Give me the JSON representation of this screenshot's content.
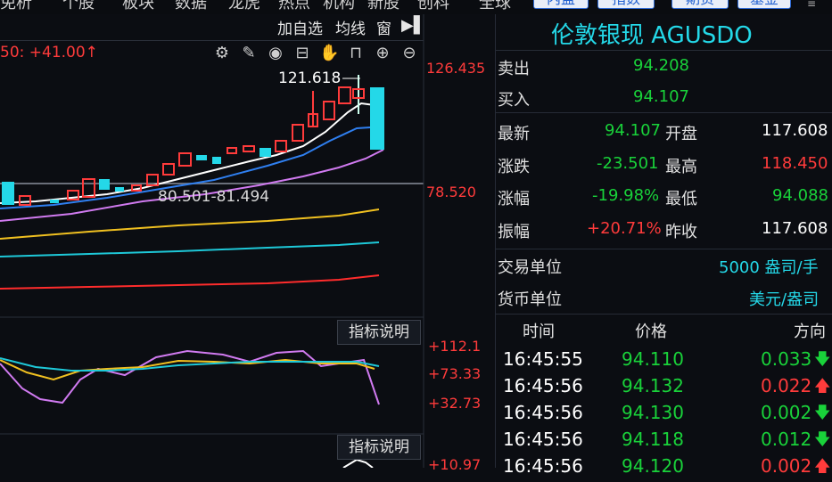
{
  "top_menu": [
    "免析",
    "个股",
    "板块",
    "数据",
    "龙虎",
    "热点",
    "机构",
    "新股",
    "创科",
    "全球"
  ],
  "top_tabs": [
    "内盘",
    "指数",
    "期货",
    "基金"
  ],
  "toolbar": {
    "add_watch": "加自选",
    "ma_label": "均线",
    "window_label": "窗"
  },
  "indicator_text": "50: +41.00↑",
  "chart": {
    "high_label": "121.618",
    "range_label": "80.501-81.494",
    "price_axis": {
      "top": "126.435",
      "mid": "78.520"
    },
    "sub1_axis": [
      "+112.1",
      "+73.33",
      "+32.73"
    ],
    "sub2_axis": [
      "+10.97"
    ],
    "indicator_button": "指标说明"
  },
  "panel": {
    "title": "伦敦银现 AGUSDO",
    "sell_label": "卖出",
    "sell_value": "94.208",
    "buy_label": "买入",
    "buy_value": "94.107",
    "stats": [
      {
        "label": "最新",
        "value": "94.107",
        "label2": "开盘",
        "value2": "117.608"
      },
      {
        "label": "涨跌",
        "value": "-23.501",
        "label2": "最高",
        "value2": "118.450"
      },
      {
        "label": "涨幅",
        "value": "-19.98%",
        "label2": "最低",
        "value2": "94.088"
      },
      {
        "label": "振幅",
        "value": "+20.71%",
        "label2": "昨收",
        "value2": "117.608"
      }
    ],
    "trade_unit_label": "交易单位",
    "trade_unit_value": "5000 盎司/手",
    "currency_label": "货币单位",
    "currency_value": "美元/盎司",
    "ticks_header": {
      "time": "时间",
      "price": "价格",
      "dir": "方向"
    },
    "ticks": [
      {
        "time": "16:45:55",
        "price": "94.110",
        "vol": "0.033",
        "dir": "down"
      },
      {
        "time": "16:45:56",
        "price": "94.132",
        "vol": "0.022",
        "dir": "up"
      },
      {
        "time": "16:45:56",
        "price": "94.130",
        "vol": "0.002",
        "dir": "down"
      },
      {
        "time": "16:45:56",
        "price": "94.118",
        "vol": "0.012",
        "dir": "down"
      },
      {
        "time": "16:45:56",
        "price": "94.120",
        "vol": "0.002",
        "dir": "up"
      }
    ]
  },
  "colors": {
    "up": "#ff3b3b",
    "down": "#19d23a",
    "cyan": "#24d8e8",
    "bg": "#0b0d12"
  },
  "icons": [
    "settings-icon",
    "draw-icon",
    "eye-icon",
    "basket-icon",
    "hand-icon",
    "lock-icon",
    "zoom-in-icon",
    "zoom-out-icon",
    "pin-icon"
  ]
}
